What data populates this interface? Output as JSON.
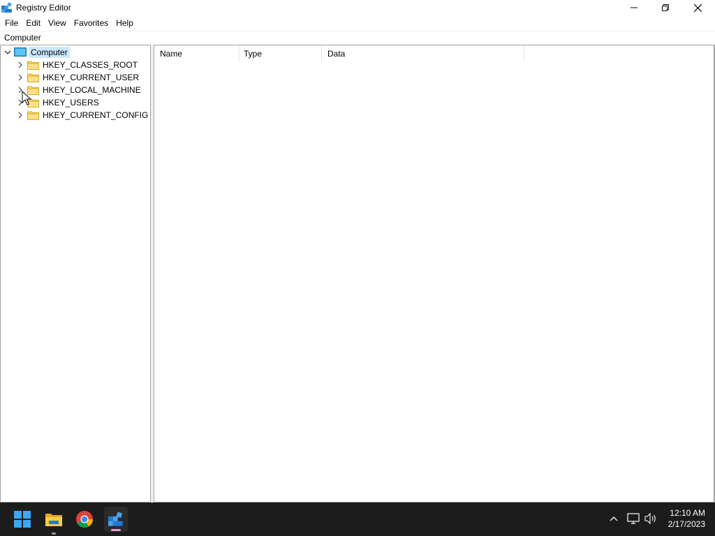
{
  "window": {
    "title": "Registry Editor",
    "icon": "registry-editor-icon"
  },
  "menu": {
    "items": [
      "File",
      "Edit",
      "View",
      "Favorites",
      "Help"
    ]
  },
  "address": {
    "path": "Computer"
  },
  "tree": {
    "root": "Computer",
    "children": [
      {
        "label": "HKEY_CLASSES_ROOT"
      },
      {
        "label": "HKEY_CURRENT_USER"
      },
      {
        "label": "HKEY_LOCAL_MACHINE"
      },
      {
        "label": "HKEY_USERS"
      },
      {
        "label": "HKEY_CURRENT_CONFIG"
      }
    ]
  },
  "list": {
    "columns": [
      "Name",
      "Type",
      "Data"
    ]
  },
  "taskbar": {
    "apps": [
      "start-icon",
      "file-explorer-icon",
      "chrome-icon",
      "registry-editor-icon"
    ],
    "time": "12:10 AM",
    "date": "2/17/2023"
  },
  "colors": {
    "selection": "#cce8ff",
    "taskbar": "#1c1c1c",
    "folder": "#f8d775",
    "accent": "#0078d4"
  }
}
